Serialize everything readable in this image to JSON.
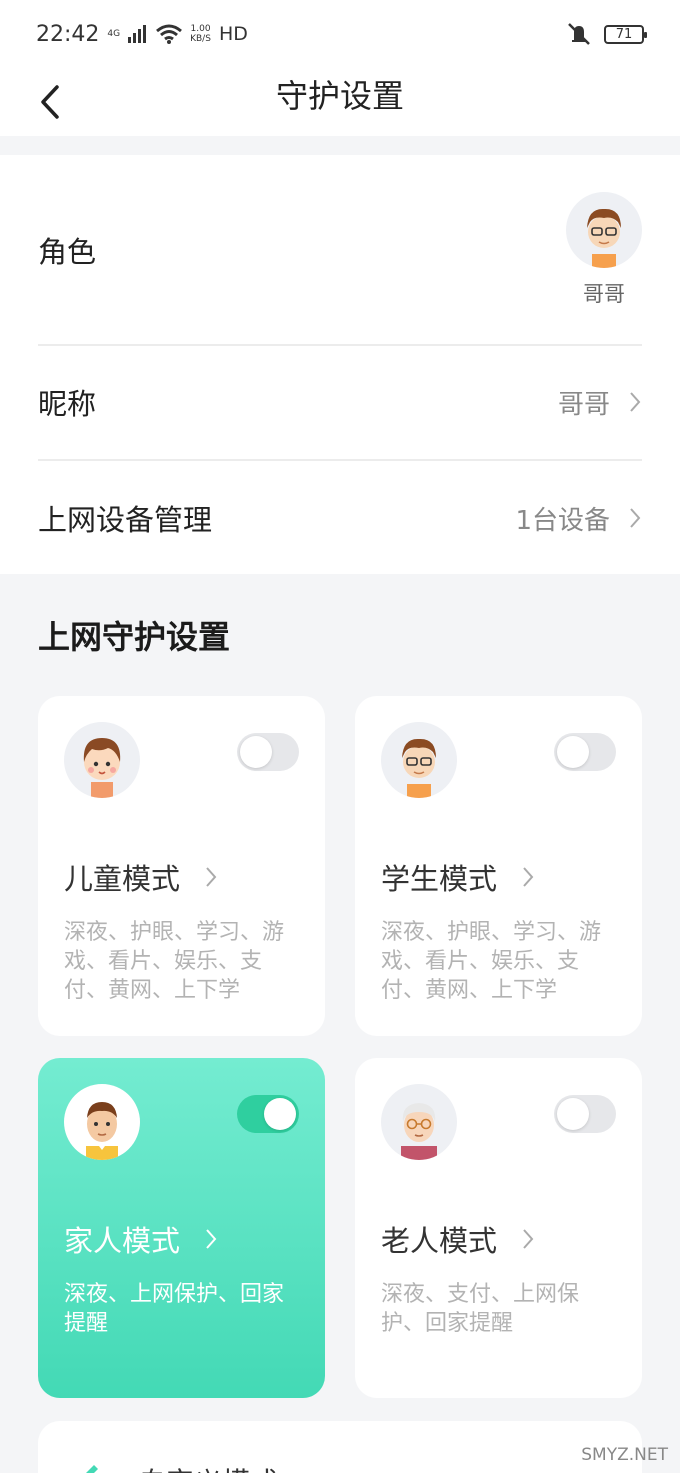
{
  "status_bar": {
    "time": "22:42",
    "network": "4G",
    "speed_value": "1.00",
    "speed_unit": "KB/S",
    "hd": "HD",
    "battery": "71"
  },
  "header": {
    "title": "守护设置",
    "back_icon": "chevron-left-icon"
  },
  "profile": {
    "role_label": "角色",
    "role_name": "哥哥",
    "nickname_label": "昵称",
    "nickname_value": "哥哥",
    "devices_label": "上网设备管理",
    "devices_value": "1台设备"
  },
  "guard": {
    "section_title": "上网守护设置",
    "modes": [
      {
        "title": "儿童模式",
        "desc": "深夜、护眼、学习、游戏、看片、娱乐、支付、黄网、上下学",
        "enabled": false,
        "avatar": "child-avatar"
      },
      {
        "title": "学生模式",
        "desc": "深夜、护眼、学习、游戏、看片、娱乐、支付、黄网、上下学",
        "enabled": false,
        "avatar": "student-avatar"
      },
      {
        "title": "家人模式",
        "desc": "深夜、上网保护、回家提醒",
        "enabled": true,
        "avatar": "family-avatar"
      },
      {
        "title": "老人模式",
        "desc": "深夜、支付、上网保护、回家提醒",
        "enabled": false,
        "avatar": "elder-avatar"
      }
    ],
    "custom_label": "自定义模式"
  },
  "watermark": "SMYZ.NET",
  "colors": {
    "accent": "#43d9b5",
    "toggle_on": "#2fcf9f",
    "background": "#f4f5f7"
  }
}
